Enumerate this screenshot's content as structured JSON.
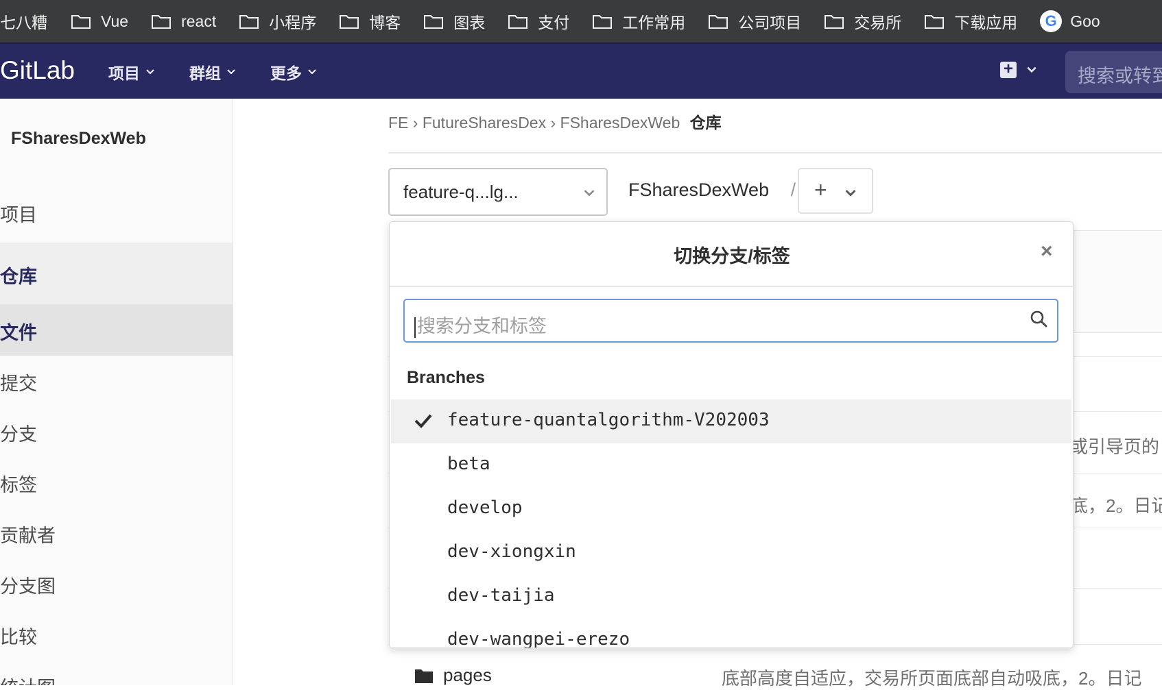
{
  "bookmarks": {
    "first": "七八糟",
    "folders": [
      "Vue",
      "react",
      "小程序",
      "博客",
      "图表",
      "支付",
      "工作常用",
      "公司项目",
      "交易所",
      "下载应用"
    ],
    "last": "Goo"
  },
  "header": {
    "logo": "GitLab",
    "nav": [
      "项目",
      "群组",
      "更多"
    ],
    "search_placeholder": "搜索或转到"
  },
  "sidebar": {
    "project_name": "FSharesDexWeb",
    "items": [
      "项目",
      "仓库",
      "文件",
      "提交",
      "分支",
      "标签",
      "贡献者",
      "分支图",
      "比较",
      "统计图"
    ]
  },
  "breadcrumb": {
    "parts": [
      "FE",
      "FutureSharesDex",
      "FSharesDexWeb"
    ],
    "current": "仓库"
  },
  "toolbar": {
    "branch_value": "feature-q...lg...",
    "repo_path": "FSharesDexWeb",
    "slash": "/",
    "add_label": "+"
  },
  "dropdown": {
    "title": "切换分支/标签",
    "close": "×",
    "search_placeholder": "搜索分支和标签",
    "section_header": "Branches",
    "branches": [
      "feature-quantalgorithm-V202003",
      "beta",
      "develop",
      "dev-xiongxin",
      "dev-taijia",
      "dev-wangpei-erezo"
    ]
  },
  "background": {
    "row_text_1": "或引导页的",
    "row_text_2": "底，2。日记",
    "file_name": "pages",
    "file_commit": "底部高度自适应，交易所页面底部自动吸底，2。日记"
  },
  "colors": {
    "bookmarks_bg": "#3a3b3d",
    "header_bg": "#292961",
    "focus_border": "#6b97d6"
  }
}
